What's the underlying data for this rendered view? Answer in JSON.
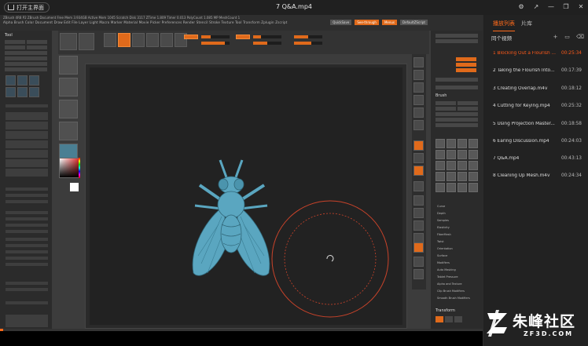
{
  "app": {
    "home_button": "打开主界面",
    "file_title": "7 Q&A.mp4"
  },
  "zbrush": {
    "menu_line": "Alpha  Brush  Color  Document  Draw  Edit  File  Layer  Light  Macro  Marker  Material  Movie  Picker  Preferences  Render  Stencil  Stroke  Texture  Tool  Transform  Zplugin  Zscript",
    "info_line": "ZBrush 4R8 P2    ZBrush Document    Free Mem 3.934GB   Active Mem 1045   Scratch Disk 3117   ZTime 1.809   Timer 0.013   PolyCount 1.085 MP   MeshCount 1",
    "top_tags": [
      "QuickSave",
      "See-through",
      "Menus",
      "DefaultZScript"
    ],
    "left_title": "Tool",
    "right_brush_title": "Brush",
    "right_transform_title": "Transform",
    "right_list": [
      "Curve",
      "Depth",
      "Samples",
      "Elasticity",
      "FiberMesh",
      "Twist",
      "Orientation",
      "Surface",
      "Modifiers",
      "Auto Masking",
      "Tablet Pressure",
      "Alpha and Texture",
      "Clip Brush Modifiers",
      "Smooth Brush Modifiers"
    ]
  },
  "playlist": {
    "tab_active": "播放列表",
    "tab_other": "片库",
    "header": "同个视频",
    "items": [
      {
        "name": "1 Blocking Out a Flourish ...",
        "duration": "00:25:34",
        "active": true
      },
      {
        "name": "2 Taking the Flourish Into...",
        "duration": "00:17:39",
        "active": false
      },
      {
        "name": "3 Creating Overlap.m4v",
        "duration": "00:18:12",
        "active": false
      },
      {
        "name": "4 Cutting for Keying.mp4",
        "duration": "00:25:32",
        "active": false
      },
      {
        "name": "5 Using Projection Master...",
        "duration": "00:18:58",
        "active": false
      },
      {
        "name": "6 Earing Discussion.mp4",
        "duration": "00:24:03",
        "active": false
      },
      {
        "name": "7 Q&A.mp4",
        "duration": "00:43:13",
        "active": false
      },
      {
        "name": "8 Cleaning Up Mesh.m4v",
        "duration": "00:24:34",
        "active": false
      }
    ]
  },
  "watermark": {
    "main": "朱峰社区",
    "sub": "ZF3D.COM"
  },
  "colors": {
    "accent": "#ff6a1a",
    "zbrush_orange": "#e06a1b",
    "model": "#5aa6c0"
  }
}
